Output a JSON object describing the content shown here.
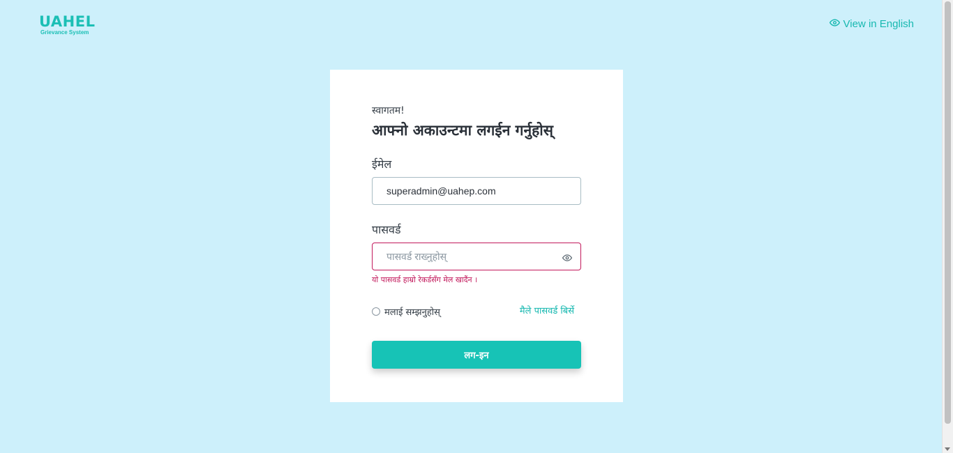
{
  "header": {
    "logo_title": "UAHEL",
    "logo_subtitle": "Grievance System",
    "language_toggle": "View in English",
    "language_icon": "eye-icon"
  },
  "login": {
    "welcome": "स्वागतम!",
    "heading": "आफ्नो अकाउन्टमा लगईन गर्नुहोस्",
    "email_label": "ईमेल",
    "email_value": "superadmin@uahep.com",
    "password_label": "पासवर्ड",
    "password_placeholder": "पासवर्ड राख्नुहोस्",
    "password_value": "",
    "password_toggle_icon": "eye-icon",
    "error_message": "यो पासवर्ड हाम्रो रेकर्डसँग मेल खादैंन ।",
    "remember_me": "मलाई सम्झनुहोस्",
    "forgot_password": "मैले पासवर्ड बिर्से",
    "login_button": "लग-इन"
  },
  "colors": {
    "background": "#cdf0fb",
    "accent": "#17c3b6",
    "error": "#c2185b"
  }
}
